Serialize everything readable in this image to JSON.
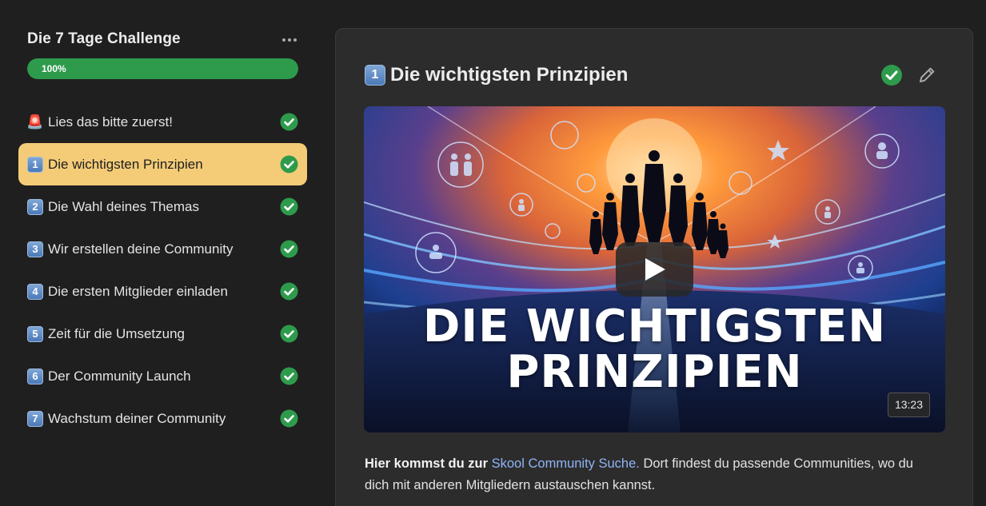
{
  "sidebar": {
    "course_title": "Die 7 Tage Challenge",
    "progress": {
      "percent": 100,
      "label": "100%"
    },
    "lessons": [
      {
        "emoji": "🚨",
        "label": "Lies das bitte zuerst!",
        "completed": true,
        "active": false
      },
      {
        "emoji": "1",
        "label": "Die wichtigsten Prinzipien",
        "completed": true,
        "active": true
      },
      {
        "emoji": "2",
        "label": "Die Wahl deines Themas",
        "completed": true,
        "active": false
      },
      {
        "emoji": "3",
        "label": "Wir erstellen deine Community",
        "completed": true,
        "active": false
      },
      {
        "emoji": "4",
        "label": "Die ersten Mitglieder einladen",
        "completed": true,
        "active": false
      },
      {
        "emoji": "5",
        "label": "Zeit für die Umsetzung",
        "completed": true,
        "active": false
      },
      {
        "emoji": "6",
        "label": "Der Community Launch",
        "completed": true,
        "active": false
      },
      {
        "emoji": "7",
        "label": "Wachstum deiner Community",
        "completed": true,
        "active": false
      }
    ]
  },
  "main": {
    "title_emoji": "1",
    "title": "Die wichtigsten Prinzipien",
    "video": {
      "headline_line1": "DIE WICHTIGSTEN",
      "headline_line2": "PRINZIPIEN",
      "duration": "13:23"
    },
    "description": {
      "bold": "Hier kommst du zur",
      "link_text": "Skool Community Suche.",
      "rest": " Dort findest du passende Communities, wo du dich mit anderen Mitgliedern austauschen kannst."
    }
  },
  "colors": {
    "accent_active": "#f4cc78",
    "progress_green": "#2e9b4c",
    "check_green": "#2e9b4c",
    "link_blue": "#8fb4f5"
  },
  "icons": {
    "more": "more-horizontal-icon",
    "check": "check-circle-icon",
    "edit": "pencil-icon",
    "play": "play-icon"
  }
}
